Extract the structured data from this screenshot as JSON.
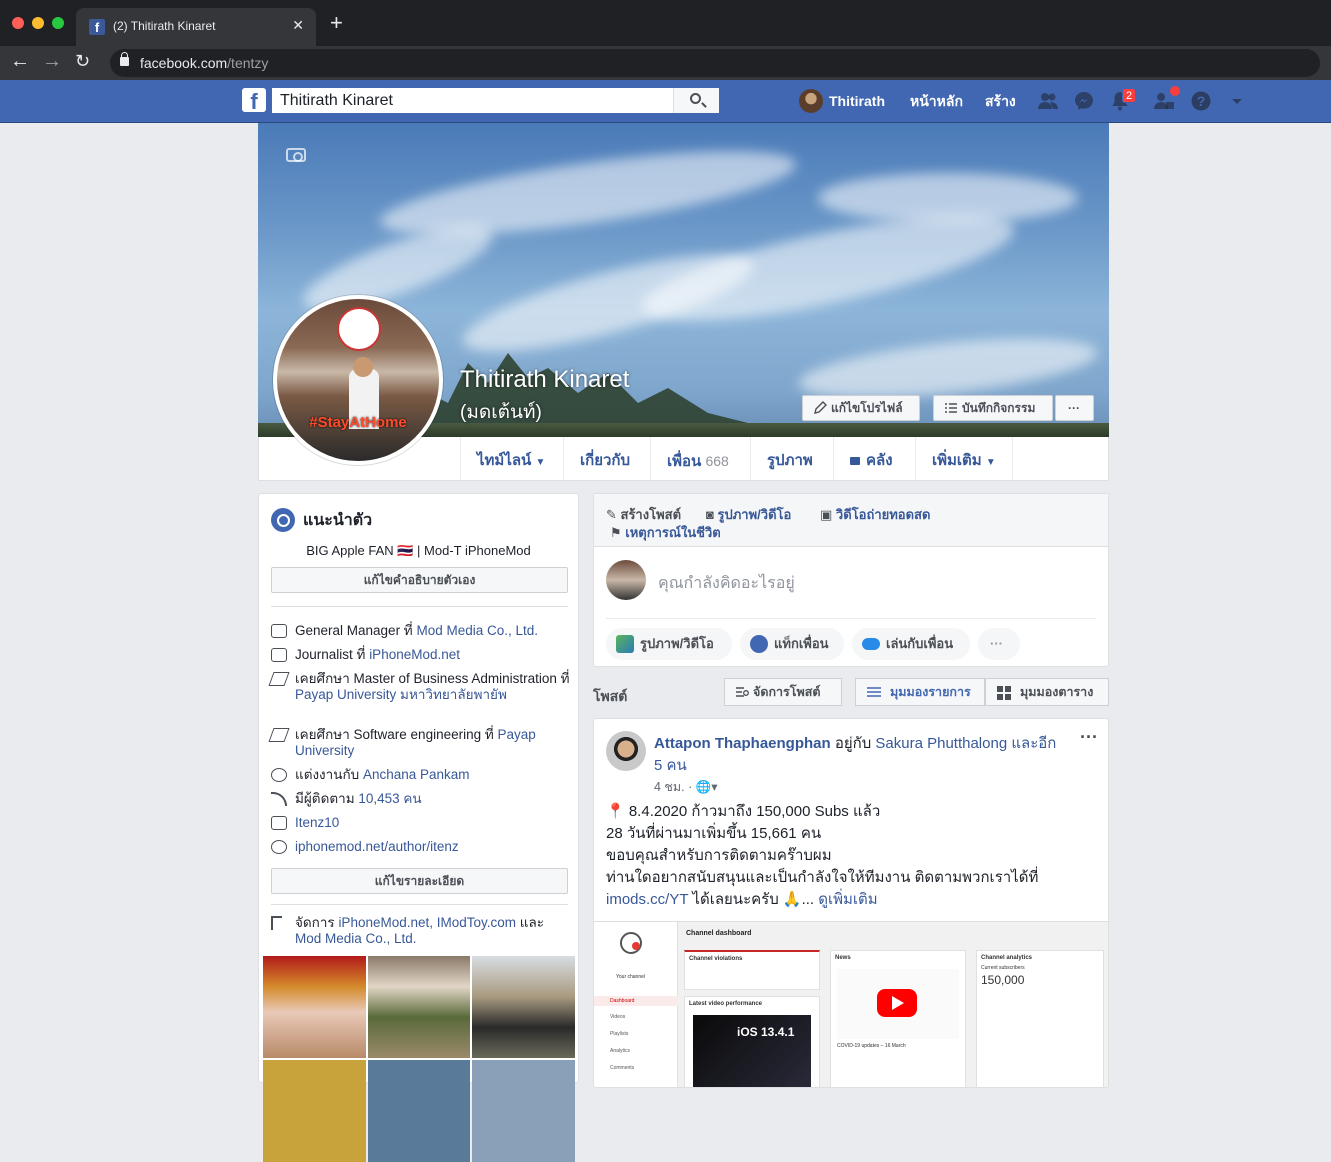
{
  "browser": {
    "tab_title": "(2) Thitirath Kinaret",
    "url_host": "facebook.com",
    "url_path": "/tentzy"
  },
  "topbar": {
    "search_value": "Thitirath Kinaret",
    "user_name": "Thitirath",
    "home": "หน้าหลัก",
    "create": "สร้าง",
    "notif_count": "2",
    "colors": {
      "brand": "#4267b2",
      "badge": "#fa3e3e"
    }
  },
  "profile": {
    "name": "Thitirath Kinaret",
    "nickname": "(มดเต้นท์)",
    "picture_text": "#StayAtHome",
    "edit_profile": "แก้ไขโปรไฟล์",
    "activity_log": "บันทึกกิจกรรม",
    "more": "···"
  },
  "tabs": {
    "timeline": "ไทม์ไลน์",
    "about": "เกี่ยวกับ",
    "friends": "เพื่อน",
    "friends_count": "668",
    "photos": "รูปภาพ",
    "archive": "คลัง",
    "more": "เพิ่มเติม"
  },
  "intro": {
    "title": "แนะนำตัว",
    "bio": "BIG  Apple FAN 🇹🇭 | Mod-T iPhoneMod",
    "edit_bio": "แก้ไขคำอธิบายตัวเอง",
    "work1_pre": "General Manager ที่ ",
    "work1_link": "Mod Media Co., Ltd.",
    "work2_pre": "Journalist ที่ ",
    "work2_link": "iPhoneMod.net",
    "edu1_pre": "เคยศึกษา Master of Business Administration ที่ ",
    "edu1_link": "Payap University มหาวิทยาลัยพายัพ",
    "edu2_pre": "เคยศึกษา Software engineering ที่ ",
    "edu2_link": "Payap University",
    "married_pre": "แต่งงานกับ ",
    "married_link": "Anchana Pankam",
    "followers_pre": "มีผู้ติดตาม ",
    "followers_link": "10,453 คน",
    "instagram": "Itenz10",
    "website": "iphonemod.net/author/itenz",
    "edit_details": "แก้ไขรายละเอียด",
    "manage_pre": "จัดการ ",
    "manage_links": "iPhoneMod.net, IModToy.com",
    "manage_and": " และ ",
    "manage_last": "Mod Media Co., Ltd."
  },
  "composer": {
    "create_post": "สร้างโพสต์",
    "photo_video": "รูปภาพ/วิดีโอ",
    "live_video": "วิดีโอถ่ายทอดสด",
    "life_event": "เหตุการณ์ในชีวิต",
    "placeholder": "คุณกำลังคิดอะไรอยู่",
    "pill_photo": "รูปภาพ/วิดีโอ",
    "pill_tag": "แท็กเพื่อน",
    "pill_play": "เล่นกับเพื่อน",
    "pill_more": "···"
  },
  "posts_bar": {
    "title": "โพสต์",
    "manage": "จัดการโพสต์",
    "list_view": "มุมมองรายการ",
    "grid_view": "มุมมองตาราง"
  },
  "post": {
    "author": "Attapon Thaphaengphan",
    "with_text": " อยู่กับ ",
    "with_name": "Sakura Phutthalong",
    "and_more": " และอีก 5 คน",
    "time": "4 ชม. · 🌐▾",
    "line1": "📍 8.4.2020 ก้าวมาถึง 150,000 Subs แล้ว",
    "line2": "28 วันที่ผ่านมาเพิ่มขึ้น 15,661 คน",
    "line3": "ขอบคุณสำหรับการติดตามคร๊าบผม",
    "line4": "ท่านใดอยากสนับสนุนและเป็นกำลังใจให้ทีมงาน ติดตามพวกเราได้ที่",
    "link": "imods.cc/YT",
    "line5_rest": " ได้เลยนะครับ 🙏... ",
    "see_more": "ดูเพิ่มเติม",
    "shot": {
      "dashboard": "Channel dashboard",
      "violations": "Channel violations",
      "news": "News",
      "analytics": "Channel analytics",
      "subs_label": "Current subscribers",
      "subs": "150,000",
      "latest": "Latest video performance",
      "ios": "iOS 13.4.1",
      "covid": "COVID-19 updates – 16 March",
      "your_channel": "Your channel",
      "menu": [
        "Dashboard",
        "Videos",
        "Playlists",
        "Analytics",
        "Comments"
      ]
    }
  }
}
